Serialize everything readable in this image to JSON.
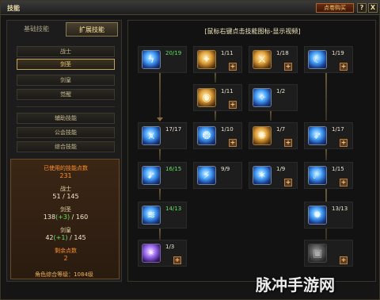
{
  "window": {
    "title": "技能",
    "shop_label": "点卷购买",
    "help_label": "?",
    "close_label": "X"
  },
  "tabs": [
    {
      "label": "基础技能"
    },
    {
      "label": "扩展技能"
    }
  ],
  "categories": [
    {
      "label": "战士"
    },
    {
      "label": "剑圣"
    },
    {
      "label": "剑皇"
    },
    {
      "label": "觉醒"
    }
  ],
  "sub_categories": [
    {
      "label": "辅助技能"
    },
    {
      "label": "公会技能"
    },
    {
      "label": "综合技能"
    }
  ],
  "stats": {
    "used_label": "已使用的技能点数",
    "used_value": "231",
    "warrior_label": "战士",
    "warrior_value": "51 / 145",
    "sword_saint_label": "剑圣",
    "sword_saint_value_a": "138",
    "sword_saint_value_bonus": "(+3)",
    "sword_saint_value_b": " / 160",
    "sword_emperor_label": "剑皇",
    "sword_emperor_value_a": "42",
    "sword_emperor_value_bonus": "(+1)",
    "sword_emperor_value_b": " / 145",
    "remaining_label": "剩余点数",
    "remaining_value": "2"
  },
  "footer": {
    "level_text": "角色综合等级：1084级"
  },
  "tree": {
    "title": "[鼠标右键点击技能图标-显示视频]",
    "skills": [
      {
        "level": "20/19",
        "color": "blue",
        "glyph": "ϟ",
        "green": true,
        "plus": false
      },
      {
        "level": "1/11",
        "color": "gold",
        "glyph": "✦",
        "green": false,
        "plus": true
      },
      {
        "level": "1/18",
        "color": "gold",
        "glyph": "⚔",
        "green": false,
        "plus": true
      },
      {
        "level": "1/19",
        "color": "blue",
        "glyph": "☾",
        "green": false,
        "plus": true
      },
      {
        "level": "1/11",
        "color": "gold",
        "glyph": "◉",
        "green": false,
        "plus": true
      },
      {
        "level": "1/2",
        "color": "blue",
        "glyph": "✧",
        "green": false,
        "plus": false
      },
      {
        "level": "17/17",
        "color": "blue",
        "glyph": "⩙",
        "green": false,
        "plus": false
      },
      {
        "level": "1/10",
        "color": "blue",
        "glyph": "❂",
        "green": false,
        "plus": true
      },
      {
        "level": "1/7",
        "color": "gold",
        "glyph": "✺",
        "green": false,
        "plus": true
      },
      {
        "level": "1/17",
        "color": "blue",
        "glyph": "➶",
        "green": false,
        "plus": true
      },
      {
        "level": "16/15",
        "color": "blue",
        "glyph": "➹",
        "green": true,
        "plus": false
      },
      {
        "level": "9/9",
        "color": "blue",
        "glyph": "⚡",
        "green": false,
        "plus": false
      },
      {
        "level": "1/9",
        "color": "blue",
        "glyph": "✶",
        "green": false,
        "plus": true
      },
      {
        "level": "1/15",
        "color": "blue",
        "glyph": "☄",
        "green": false,
        "plus": true
      },
      {
        "level": "14/13",
        "color": "blue",
        "glyph": "≋",
        "green": true,
        "plus": false
      },
      {
        "level": "13/13",
        "color": "blue",
        "glyph": "✹",
        "green": false,
        "plus": false
      },
      {
        "level": "1/3",
        "color": "purple",
        "glyph": "✴",
        "green": false,
        "plus": true
      },
      {
        "level": "",
        "color": "gray",
        "glyph": "▣",
        "green": false,
        "plus": true
      }
    ]
  },
  "watermark": "脉冲手游网",
  "colors": {
    "accent_gold": "#ffd87a",
    "bonus_green": "#5fe35f",
    "highlight_orange": "#ff8f2a"
  }
}
